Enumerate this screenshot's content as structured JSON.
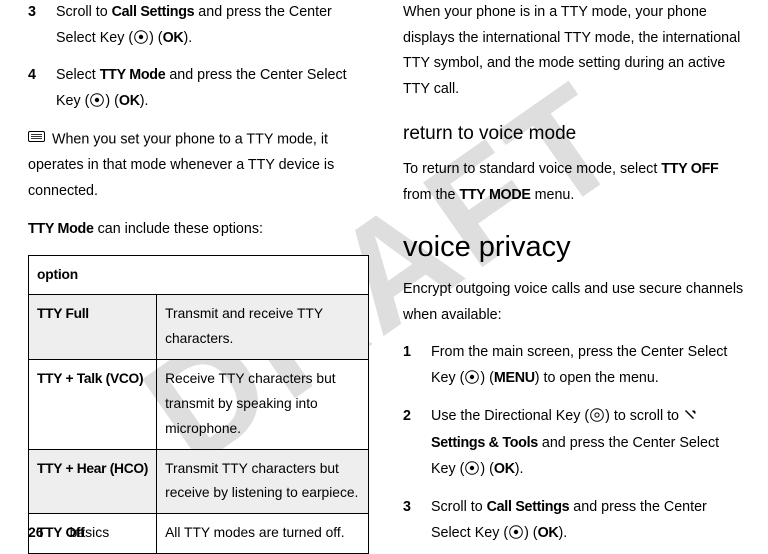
{
  "watermark": "DRAFT",
  "left": {
    "step3_num": "3",
    "step3_txt_a": "Scroll to ",
    "step3_call": "Call Settings",
    "step3_txt_b": " and press the Center Select Key (",
    "step3_txt_c": ") (",
    "step3_ok": "OK",
    "step3_txt_d": ").",
    "step4_num": "4",
    "step4_txt_a": "Select ",
    "step4_tty": "TTY Mode",
    "step4_txt_b": " and press the Center Select Key (",
    "step4_txt_c": ") (",
    "step4_ok": "OK",
    "step4_txt_d": ").",
    "note": " When you set your phone to a TTY mode, it operates in that mode whenever a TTY device is connected.",
    "opts_intro_a": "TTY Mode",
    "opts_intro_b": " can include these options:",
    "table_header": "option",
    "row1_name": "TTY Full",
    "row1_desc": "Transmit and receive TTY characters.",
    "row2_name": "TTY + Talk (VCO)",
    "row2_desc": "Receive TTY characters but transmit by speaking into microphone.",
    "row3_name": "TTY + Hear (HCO)",
    "row3_desc": "Transmit TTY characters but receive by listening to earpiece.",
    "row4_name": "TTY Off",
    "row4_desc": "All TTY modes are turned off."
  },
  "right": {
    "p1": "When your phone is in a TTY mode, your phone displays the international TTY mode, the international TTY symbol, and the mode setting during an active TTY call.",
    "h2": "return to voice mode",
    "p2_a": "To return to standard voice mode, select ",
    "p2_tty_off": "TTY OFF",
    "p2_b": " from the ",
    "p2_tty_mode": "TTY MODE",
    "p2_c": " menu.",
    "h1": "voice privacy",
    "p3": "Encrypt outgoing voice calls and use secure channels when available:",
    "s1_num": "1",
    "s1_a": "From the main screen, press the Center Select Key (",
    "s1_b": ") (",
    "s1_menu": "MENU",
    "s1_c": ") to open the menu.",
    "s2_num": "2",
    "s2_a": "Use the Directional Key (",
    "s2_b": ") to scroll to ",
    "s2_set": " Settings & Tools",
    "s2_c": " and press the Center Select Key (",
    "s2_d": ") (",
    "s2_ok": "OK",
    "s2_e": ").",
    "s3_num": "3",
    "s3_a": "Scroll to ",
    "s3_call": "Call Settings",
    "s3_b": " and press the Center Select Key (",
    "s3_c": ") (",
    "s3_ok": "OK",
    "s3_d": ")."
  },
  "footer": {
    "page": "26",
    "section": "basics"
  }
}
